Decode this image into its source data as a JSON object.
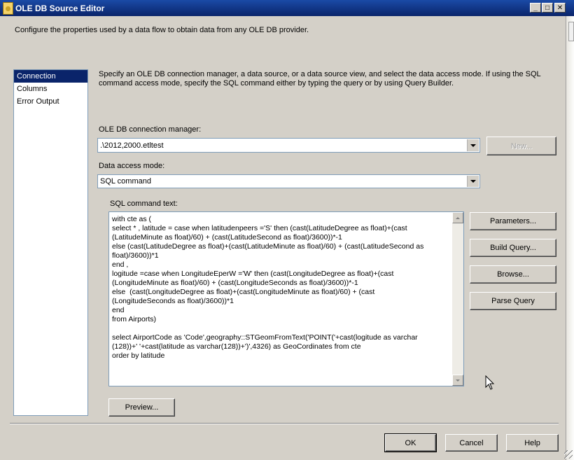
{
  "window": {
    "title": "OLE DB Source Editor",
    "controls": [
      "_",
      "□",
      "✕"
    ]
  },
  "intro_text": "Configure the properties used by a data flow to obtain data from any OLE DB provider.",
  "nav": {
    "items": [
      {
        "label": "Connection Manager",
        "selected": true
      },
      {
        "label": "Columns",
        "selected": false
      },
      {
        "label": "Error Output",
        "selected": false
      }
    ]
  },
  "main": {
    "description": "Specify an OLE DB connection manager, a data source, or a data source view, and select the data access mode. If using the SQL command access mode, specify the SQL command either by typing the query or by using Query Builder.",
    "connection_label": "OLE DB connection manager:",
    "connection_value": ".\\2012,2000.etltest",
    "new_button": "New...",
    "access_mode_label": "Data access mode:",
    "access_mode_value": "SQL command",
    "sql_label": "SQL command text:",
    "sql_text": "with cte as (\nselect * , latitude = case when latitudenpeers ='S' then (cast(LatitudeDegree as float)+(cast\n(LatitudeMinute as float)/60) + (cast(LatitudeSecond as float)/3600))*-1\nelse (cast(LatitudeDegree as float)+(cast(LatitudeMinute as float)/60) + (cast(LatitudeSecond as\nfloat)/3600))*1\nend ,\nlogitude =case when LongitudeEperW ='W' then (cast(LongitudeDegree as float)+(cast\n(LongitudeMinute as float)/60) + (cast(LongitudeSeconds as float)/3600))*-1\nelse  (cast(LongitudeDegree as float)+(cast(LongitudeMinute as float)/60) + (cast\n(LongitudeSeconds as float)/3600))*1\nend\nfrom Airports)\n\nselect AirportCode as 'Code',geography::STGeomFromText('POINT('+cast(logitude as varchar\n(128))+' '+cast(latitude as varchar(128))+')',4326) as GeoCordinates from cte\norder by latitude",
    "side_buttons": {
      "parameters": "Parameters...",
      "build_query": "Build Query...",
      "browse": "Browse...",
      "parse_query": "Parse Query"
    },
    "preview_button": "Preview..."
  },
  "footer": {
    "ok": "OK",
    "cancel": "Cancel",
    "help": "Help"
  }
}
